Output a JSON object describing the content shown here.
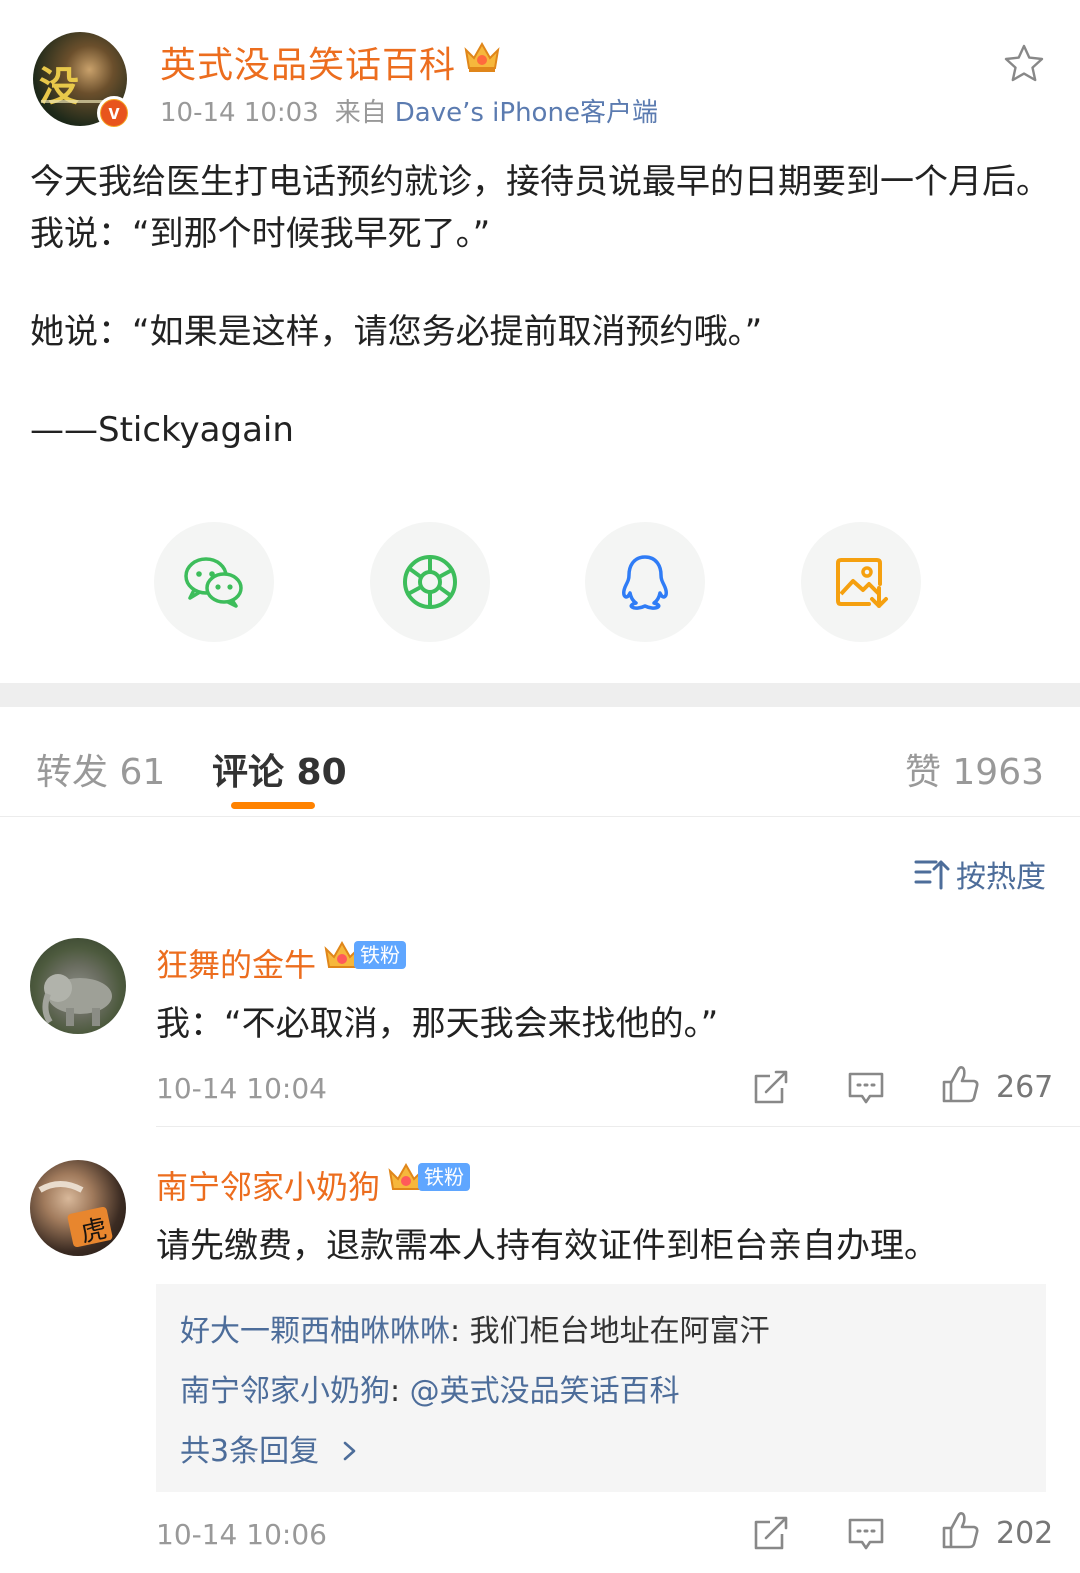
{
  "post": {
    "author": "英式没品笑话百科",
    "avatar_text": "没",
    "time": "10-14 10:03",
    "from_label": "来自",
    "source": "Dave’s iPhone客户端",
    "paragraphs": [
      "今天我给医生打电话预约就诊，接待员说最早的日期要到一个月后。我说：“到那个时候我早死了。”",
      "她说：“如果是这样，请您务必提前取消预约哦。”",
      "——Stickyagain"
    ]
  },
  "share": {
    "items": [
      {
        "icon": "wechat-icon"
      },
      {
        "icon": "moments-icon"
      },
      {
        "icon": "qq-icon"
      },
      {
        "icon": "save-image-icon"
      }
    ]
  },
  "tabs": {
    "repost": "转发 61",
    "comments": "评论 80",
    "likes": "赞 1963"
  },
  "sort": {
    "label": "按热度"
  },
  "comments": [
    {
      "name": "狂舞的金牛",
      "badge": "铁粉",
      "text": "我：“不必取消，那天我会来找他的。”",
      "time": "10-14 10:04",
      "likes": "267"
    },
    {
      "name": "南宁邻家小奶狗",
      "badge": "铁粉",
      "text": "请先缴费，退款需本人持有效证件到柜台亲自办理。",
      "time": "10-14 10:06",
      "likes": "202",
      "replies": [
        {
          "name": "好大一颗西柚咻咻咻",
          "text": "我们柜台地址在阿富汗"
        },
        {
          "name": "南宁邻家小奶狗",
          "text": "@英式没品笑话百科"
        }
      ],
      "more": "共3条回复"
    }
  ],
  "colors": {
    "accent_orange": "#ff8200",
    "name_orange": "#ec6d1e",
    "link_blue": "#4d6d9a",
    "fan_badge_blue": "#5fa6ff"
  }
}
